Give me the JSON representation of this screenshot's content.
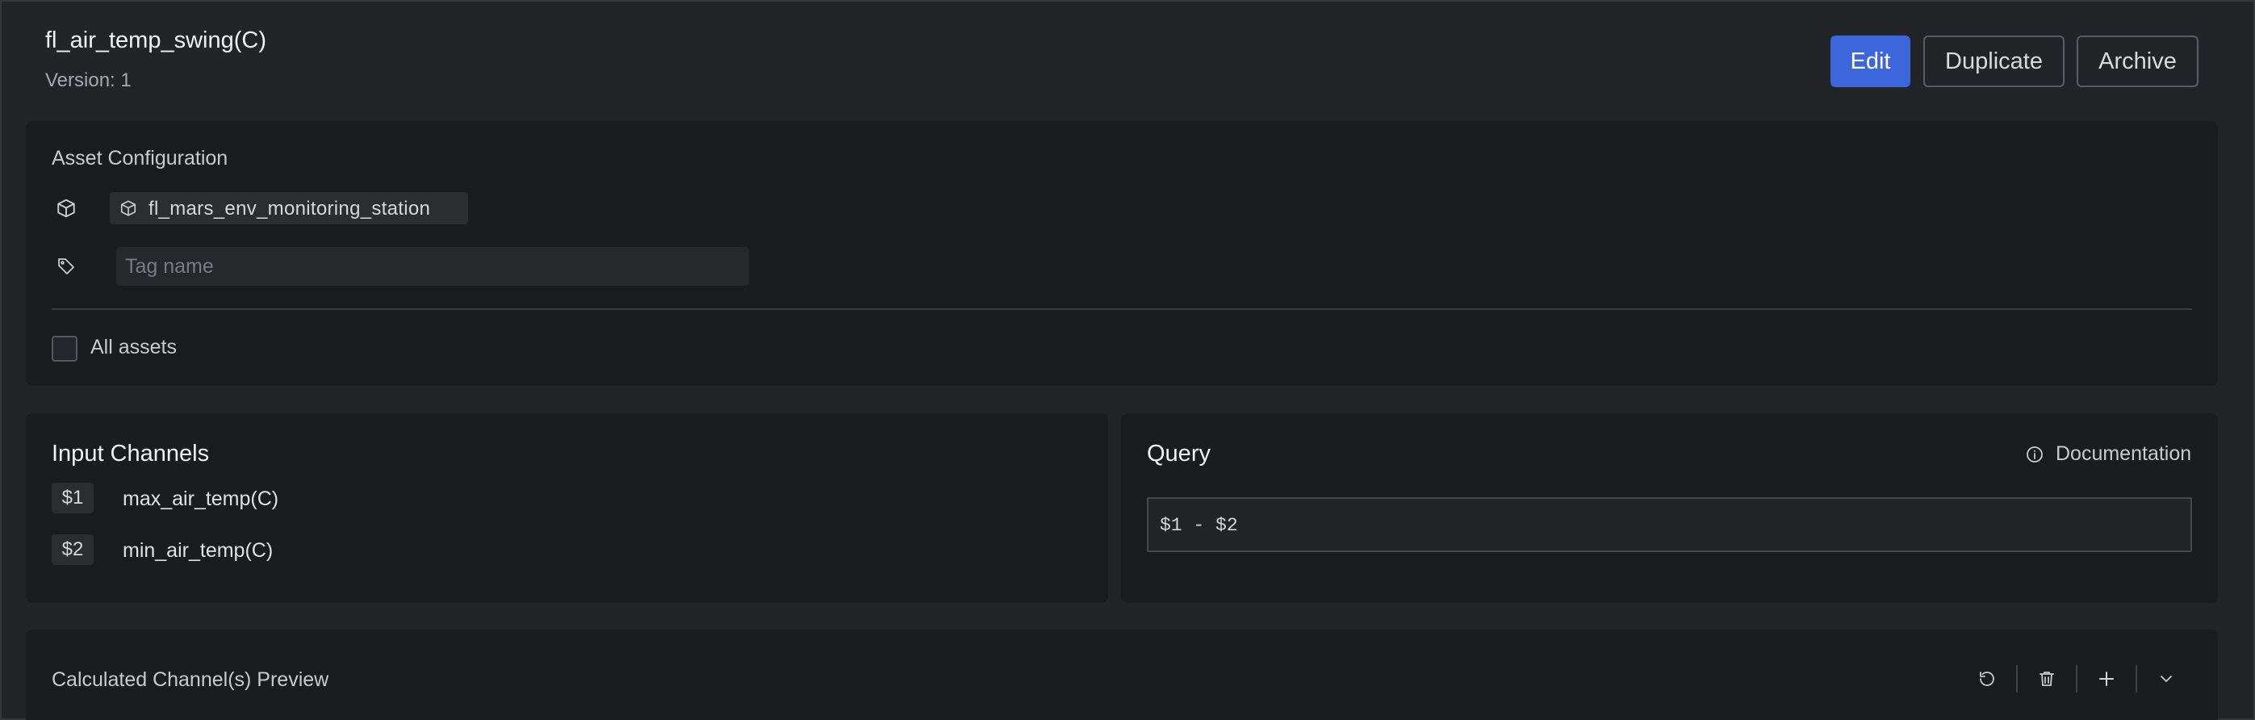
{
  "header": {
    "title": "fl_air_temp_swing(C)",
    "version": "Version: 1",
    "edit_label": "Edit",
    "duplicate_label": "Duplicate",
    "archive_label": "Archive"
  },
  "asset_config": {
    "title": "Asset Configuration",
    "asset_icon": "cube-icon",
    "asset_name": "fl_mars_env_monitoring_station",
    "tag_icon": "tag-icon",
    "tag_placeholder": "Tag name",
    "all_assets_label": "All assets",
    "all_assets_checked": false
  },
  "input_channels": {
    "title": "Input Channels",
    "channels": [
      {
        "var": "$1",
        "name": "max_air_temp(C)"
      },
      {
        "var": "$2",
        "name": "min_air_temp(C)"
      }
    ]
  },
  "query": {
    "title": "Query",
    "documentation_label": "Documentation",
    "documentation_icon": "info-icon",
    "expression": "$1 - $2"
  },
  "preview": {
    "title": "Calculated Channel(s) Preview",
    "tools": [
      "refresh-icon",
      "trash-icon",
      "plus-icon",
      "chevron-down-icon"
    ]
  },
  "colors": {
    "accent": "#3d66dc",
    "background": "#232427",
    "card": "#1b1c1e"
  }
}
